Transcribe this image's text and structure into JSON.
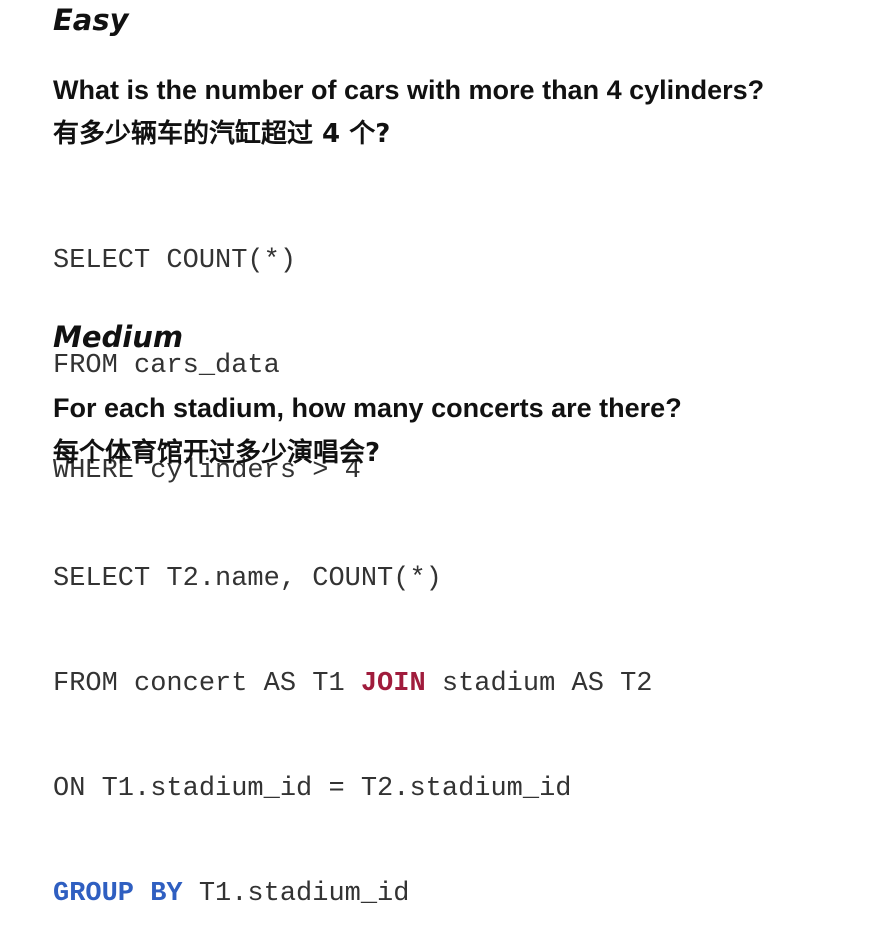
{
  "easy": {
    "level": "Easy",
    "question_en": "What is the number of cars with more than 4 cylinders?",
    "question_zh": "有多少辆车的汽缸超过 4 个?",
    "sql": [
      "SELECT COUNT(*)",
      "FROM cars_data",
      "WHERE cylinders > 4"
    ]
  },
  "medium": {
    "level": "Medium",
    "question_en": "For each stadium, how many concerts are there?",
    "question_zh": "每个体育馆开过多少演唱会?",
    "sql_line1": "SELECT T2.name, COUNT(*)",
    "sql_line2_a": "FROM concert AS T1 ",
    "sql_line2_kw": "JOIN",
    "sql_line2_b": " stadium AS T2",
    "sql_line3": "ON T1.stadium_id = T2.stadium_id",
    "sql_line4_kw": "GROUP BY",
    "sql_line4_b": " T1.stadium_id"
  },
  "colors": {
    "join_keyword": "#a01c3c",
    "group_by_keyword": "#2f5fc1"
  }
}
